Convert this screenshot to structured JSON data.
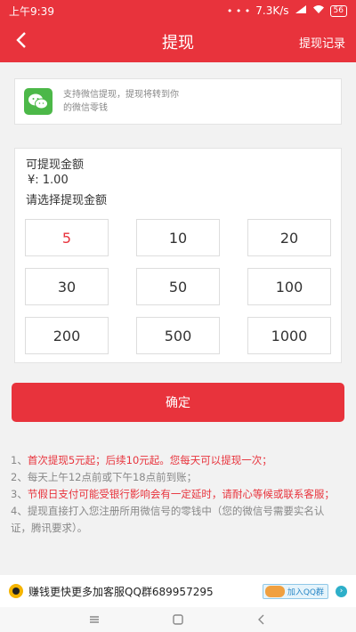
{
  "status": {
    "time": "上午9:39",
    "dots": "• • •",
    "speed": "7.3K/s",
    "battery": "56",
    "colors": {
      "accent": "#e8333c"
    }
  },
  "header": {
    "back_icon": "chevron-left-icon",
    "title": "提现",
    "record_label": "提现记录"
  },
  "wechat": {
    "icon": "wechat-icon",
    "text": "支持微信提现，提现将转到你的微信零钱"
  },
  "amount": {
    "available_label": "可提现金额",
    "balance": "¥: 1.00",
    "choose_label": "请选择提现金额",
    "options": [
      "5",
      "10",
      "20",
      "30",
      "50",
      "100",
      "200",
      "500",
      "1000"
    ],
    "selected": "5"
  },
  "confirm_label": "确定",
  "notes": [
    {
      "prefix": "1、",
      "text": "首次提现5元起；后续10元起。您每天可以提现一次；",
      "highlight": true
    },
    {
      "prefix": "2、",
      "text": "每天上午12点前或下午18点前到账；",
      "highlight": false
    },
    {
      "prefix": "3、",
      "text": "节假日支付可能受银行影响会有一定延时，请耐心等候或联系客服；",
      "highlight": true
    },
    {
      "prefix": "4、",
      "text": "提现直接打入您注册所用微信号的零钱中（您的微信号需要实名认证，腾讯要求）。",
      "highlight": false
    }
  ],
  "qq": {
    "text": "赚钱更快更多加客服QQ群689957295",
    "join_label": "加入QQ群"
  },
  "nav": {
    "menu_icon": "menu-icon",
    "home_icon": "home-icon",
    "back_icon": "back-icon"
  }
}
